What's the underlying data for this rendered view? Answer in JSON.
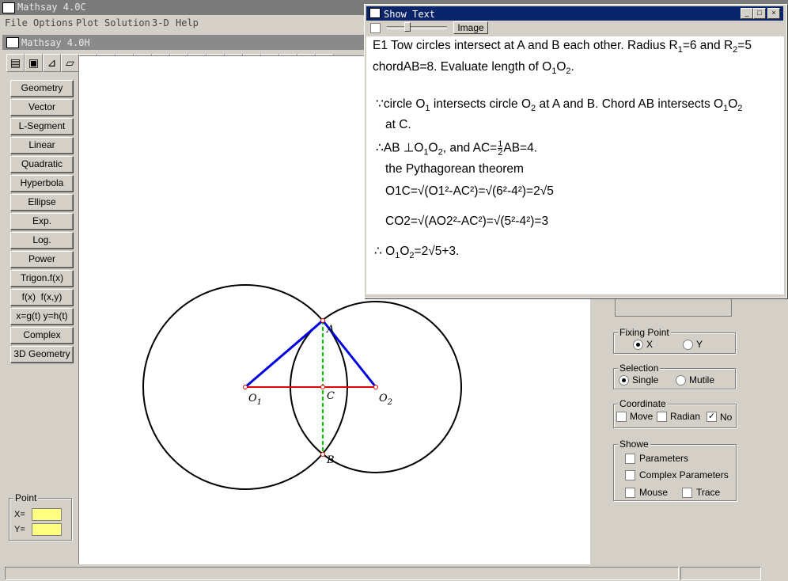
{
  "app": {
    "title": "Mathsay 4.0C",
    "menu": [
      "File",
      "Options",
      "Plot",
      "Solution",
      "3-D",
      "Help"
    ],
    "doc_title": "Mathsay 4.0H"
  },
  "toolbar": {
    "icons": [
      "open-icon",
      "save-icon",
      "draw-icon",
      "erase-icon",
      "ruler-icon",
      "angle-icon",
      "triangle-icon",
      "intersect-icon",
      "pen-icon",
      "wrench-icon",
      "enter-icon",
      "plus-icon",
      "minus-icon",
      "omega-icon",
      "target-icon",
      "contrast-icon",
      "pencil-icon",
      "window-icon"
    ]
  },
  "sidebar": {
    "buttons": [
      "Geometry",
      "Vector",
      "L-Segment",
      "Linear",
      "Quadratic",
      "Hyperbola",
      "Ellipse",
      "Exp.",
      "Log.",
      "Power",
      "Trigon.f(x)",
      "f(x)  f(x,y)",
      "x=g(t) y=h(t)",
      "Complex",
      "3D Geometry"
    ]
  },
  "point": {
    "label": "Point",
    "x_label": "X=",
    "y_label": "Y=",
    "x_value": "",
    "y_value": ""
  },
  "right_panel": {
    "fixing_point": {
      "label": "Fixing Point",
      "x": "X",
      "y": "Y",
      "selected": "X"
    },
    "selection": {
      "label": "Selection",
      "single": "Single",
      "mutile": "Mutile",
      "selected": "Single"
    },
    "coordinate": {
      "label": "Coordinate",
      "move": "Move",
      "radian": "Radian",
      "no": "No",
      "no_checked": true
    },
    "showe": {
      "label": "Showe",
      "parameters": "Parameters",
      "complex_parameters": "Complex Parameters",
      "mouse": "Mouse",
      "trace": "Trace"
    }
  },
  "figure": {
    "labels": {
      "O1": "O",
      "O1_sub": "1",
      "O2": "O",
      "O2_sub": "2",
      "A": "A",
      "B": "B",
      "C": "C"
    },
    "colors": {
      "circle": "#000000",
      "radius": "#0000ff",
      "center_line": "#ff0000",
      "chord": "#00cc00"
    }
  },
  "popup": {
    "title": "Show Text",
    "image_button": "Image",
    "minimize": "_",
    "maximize": "□",
    "close": "×",
    "lines": {
      "l1a": "E1 Tow circles intersect at A and B each other. Radius R",
      "l1b": "=6 and R",
      "l1c": "=5",
      "l2": "chordAB=8. Evaluate length of O",
      "l3a": "∵circle O",
      "l3b": " intersects circle O",
      "l3c": " at A and B. Chord AB intersects O",
      "l4": "at C.",
      "l5a": "∴AB ⊥O",
      "l5b": ", and AC=",
      "l5c": "AB=4.",
      "l6": "the Pythagorean theorem",
      "l7": "O1C=√(O1²-AC²)=√(6²-4²)=2√5",
      "l8": "CO2=√(AO2²-AC²)=√(5²-4²)=3",
      "l9a": "∴ O",
      "l9b": "=2√5+3."
    }
  }
}
